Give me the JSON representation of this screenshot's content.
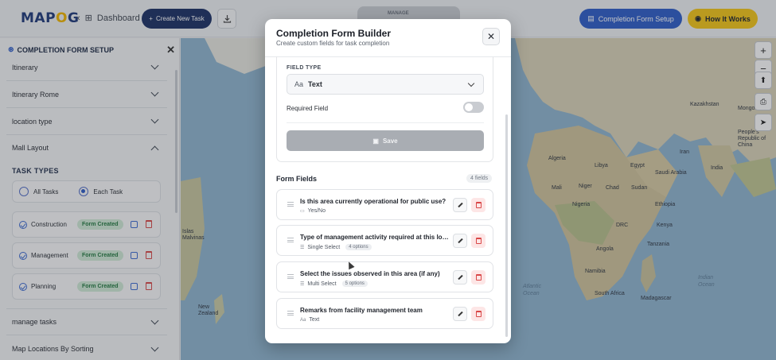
{
  "topbar": {
    "logo_prefix": "MAP",
    "logo_g": "O",
    "logo_suffix": "G",
    "back_label": "Dashboard",
    "create_task_label": "Create New Task",
    "manage_tab_label": "MANAGE",
    "completion_form_setup_label": "Completion Form Setup",
    "how_it_works_label": "How It Works"
  },
  "sidebar": {
    "title": "COMPLETION FORM SETUP",
    "rows": [
      {
        "label": "Itinerary"
      },
      {
        "label": "Itinerary Rome"
      },
      {
        "label": "location type"
      },
      {
        "label": "Mall Layout"
      }
    ],
    "task_types_heading": "TASK TYPES",
    "radio_all": "All Tasks",
    "radio_each": "Each Task",
    "tasks": [
      {
        "name": "Construction",
        "badge": "Form Created"
      },
      {
        "name": "Management",
        "badge": "Form Created"
      },
      {
        "name": "Planning",
        "badge": "Form Created"
      }
    ],
    "bottom_rows": [
      {
        "label": "manage tasks"
      },
      {
        "label": "Map Locations By Sorting"
      }
    ]
  },
  "map": {
    "labels": {
      "libya": "Libya",
      "egypt": "Egypt",
      "algeria": "Algeria",
      "mali": "Mali",
      "niger": "Niger",
      "nigeria": "Nigeria",
      "chad": "Chad",
      "sudan": "Sudan",
      "ethiopia": "Ethiopia",
      "kenya": "Kenya",
      "drc": "DRC",
      "tanzania": "Tanzania",
      "angola": "Angola",
      "namibia": "Namibia",
      "south_africa": "South Africa",
      "madagascar": "Madagascar",
      "saudi": "Saudi Arabia",
      "iran": "Iran",
      "india": "India",
      "china": "People's Republic of China",
      "kazakhstan": "Kazakhstan",
      "mongolia": "Mongolia",
      "atlantic": "Atlantic Ocean",
      "indian": "Indian Ocean",
      "nz": "New Zealand",
      "malvinas": "Islas Malvinas"
    }
  },
  "modal": {
    "title": "Completion Form Builder",
    "subtitle": "Create custom fields for task completion",
    "field_type_label": "FIELD TYPE",
    "field_type_icon": "Aa",
    "field_type_value": "Text",
    "required_label": "Required Field",
    "required_on": false,
    "save_label": "Save",
    "form_fields_title": "Form Fields",
    "form_fields_count": "4 fields",
    "fields": [
      {
        "name": "Is this area currently operational for public use?",
        "type": "Yes/No",
        "options": ""
      },
      {
        "name": "Type of management activity required at this location?",
        "type": "Single Select",
        "options": "4 options"
      },
      {
        "name": "Select the issues observed in this area (if any)",
        "type": "Multi Select",
        "options": "5 options"
      },
      {
        "name": "Remarks from facility management team",
        "type": "Text",
        "options": ""
      }
    ]
  },
  "colors": {
    "navy": "#1d3166",
    "blue": "#2f5ec8",
    "yellow": "#f3c518",
    "green_badge": "#cfe9d6",
    "delete_red": "#d94848"
  }
}
